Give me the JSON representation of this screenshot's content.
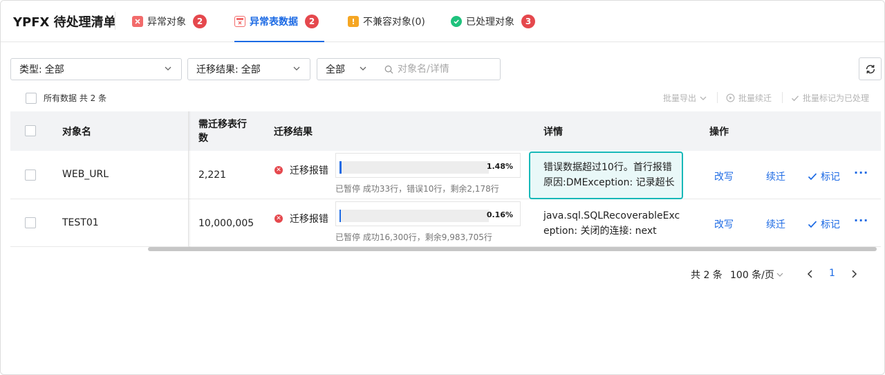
{
  "header": {
    "title": "YPFX 待处理清单",
    "tabs": [
      {
        "label": "异常对象",
        "badge": "2",
        "icon": "error-box-icon",
        "color": "#f05a5a"
      },
      {
        "label": "异常表数据",
        "badge": "2",
        "icon": "error-table-icon",
        "color": "#f05a5a"
      },
      {
        "label": "不兼容对象(0)",
        "icon": "warning-icon",
        "color": "#f5a623"
      },
      {
        "label": "已处理对象",
        "badge": "3",
        "icon": "check-circle-icon",
        "color": "#1fc27d"
      }
    ],
    "active_tab": 1
  },
  "filters": {
    "type_label": "类型:",
    "type_value": "全部",
    "result_label": "迁移结果:",
    "result_value": "全部",
    "scope_value": "全部",
    "search_placeholder": "对象名/详情"
  },
  "toolbar": {
    "select_all_label": "所有数据 共 2 条",
    "bulk_export": "批量导出",
    "bulk_resume": "批量续迁",
    "bulk_mark": "批量标记为已处理"
  },
  "table": {
    "columns": {
      "name": "对象名",
      "rows_needed": "需迁移表行数",
      "result": "迁移结果",
      "detail": "详情",
      "ops": "操作"
    },
    "rows": [
      {
        "name": "WEB_URL",
        "rows_needed": "2,221",
        "status": "迁移报错",
        "progress_pct": "1.48%",
        "progress": 1.48,
        "progress_note": "已暂停 成功33行，错误10行，剩余2,178行",
        "detail_line1": "错误数据超过10行。首行报错",
        "detail_line2": "原因:DMException: 记录超长",
        "highlighted": true
      },
      {
        "name": "TEST01",
        "rows_needed": "10,000,005",
        "status": "迁移报错",
        "progress_pct": "0.16%",
        "progress": 0.16,
        "progress_note": "已暂停 成功16,300行，剩余9,983,705行",
        "detail_line1": "java.sql.SQLRecoverableExc",
        "detail_line2": "eption: 关闭的连接: next",
        "highlighted": false
      }
    ],
    "actions": {
      "rewrite": "改写",
      "resume": "续迁",
      "mark": "标记",
      "more": "···"
    }
  },
  "pagination": {
    "total": "共 2 条",
    "page_size": "100 条/页",
    "current_page": "1"
  },
  "colors": {
    "accent": "#1c6ae4",
    "error": "#e5484d",
    "highlight_border": "#17b8b8"
  }
}
